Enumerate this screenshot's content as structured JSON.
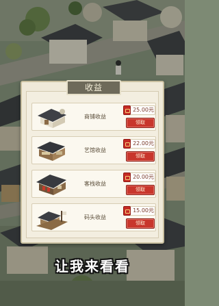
{
  "panel": {
    "title": "收益",
    "items": [
      {
        "label": "商铺收益",
        "amount": "25.00元",
        "button": "领取",
        "thumb": "shop-building"
      },
      {
        "label": "艺馆收益",
        "amount": "22.00元",
        "button": "领取",
        "thumb": "art-house-building"
      },
      {
        "label": "客栈收益",
        "amount": "20.00元",
        "button": "领取",
        "thumb": "inn-building"
      },
      {
        "label": "码头收益",
        "amount": "15.00元",
        "button": "领取",
        "thumb": "dock-building"
      }
    ]
  },
  "subtitle": "让我来看看",
  "colors": {
    "panel_bg": "#efe9d8",
    "title_tab": "#6e6a5a",
    "claim_button": "#c8362c",
    "coin": "#c52a24"
  }
}
